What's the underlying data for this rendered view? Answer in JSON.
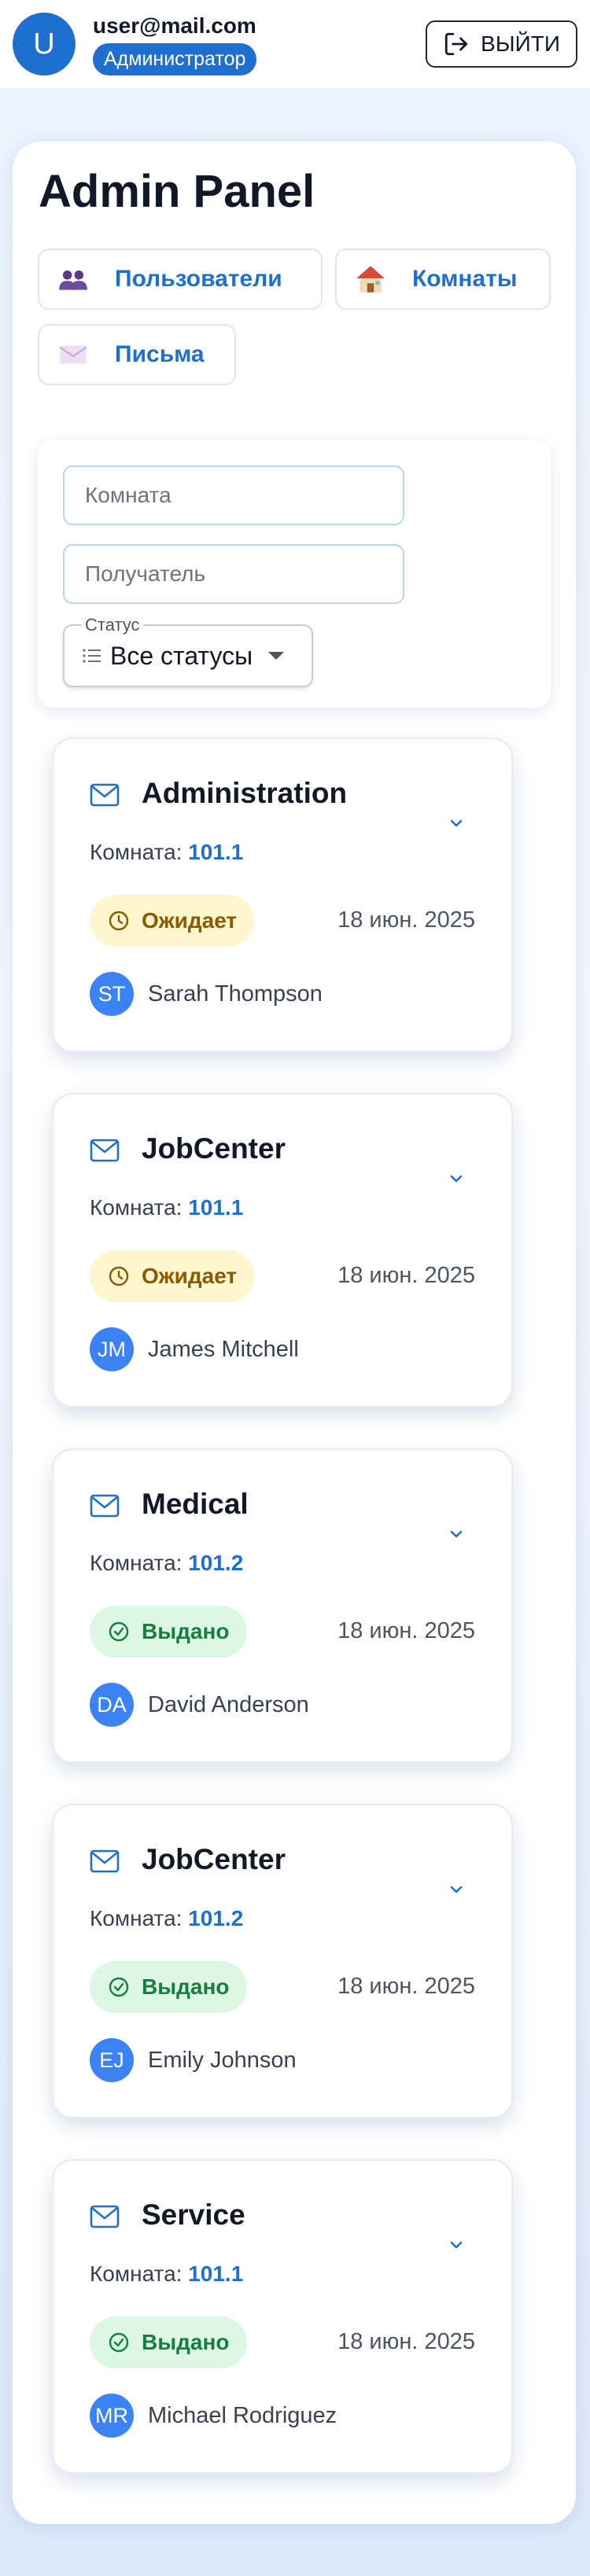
{
  "header": {
    "avatar_letter": "U",
    "email": "user@mail.com",
    "role": "Администратор",
    "logout_label": "ВЫЙТИ"
  },
  "panel": {
    "title": "Admin Panel",
    "nav": [
      {
        "label": "Пользователи",
        "icon": "users-icon"
      },
      {
        "label": "Комнаты",
        "icon": "house-icon"
      },
      {
        "label": "Письма",
        "icon": "envelope-icon"
      }
    ]
  },
  "filters": {
    "room_placeholder": "Комната",
    "recipient_placeholder": "Получатель",
    "status_label": "Статус",
    "status_value": "Все статусы"
  },
  "mails": [
    {
      "title": "Administration",
      "room_label": "Комната:",
      "room": "101.1",
      "status": "Ожидает",
      "status_type": "waiting",
      "date": "18 июн. 2025",
      "initials": "ST",
      "sender": "Sarah Thompson"
    },
    {
      "title": "JobCenter",
      "room_label": "Комната:",
      "room": "101.1",
      "status": "Ожидает",
      "status_type": "waiting",
      "date": "18 июн. 2025",
      "initials": "JM",
      "sender": "James Mitchell"
    },
    {
      "title": "Medical",
      "room_label": "Комната:",
      "room": "101.2",
      "status": "Выдано",
      "status_type": "issued",
      "date": "18 июн. 2025",
      "initials": "DA",
      "sender": "David Anderson"
    },
    {
      "title": "JobCenter",
      "room_label": "Комната:",
      "room": "101.2",
      "status": "Выдано",
      "status_type": "issued",
      "date": "18 июн. 2025",
      "initials": "EJ",
      "sender": "Emily Johnson"
    },
    {
      "title": "Service",
      "room_label": "Комната:",
      "room": "101.1",
      "status": "Выдано",
      "status_type": "issued",
      "date": "18 июн. 2025",
      "initials": "MR",
      "sender": "Michael Rodriguez"
    }
  ],
  "colors": {
    "accent": "#1f6fd1",
    "waiting_bg": "#fdf6cf",
    "waiting_text": "#8a5a00",
    "issued_bg": "#dcf7e4",
    "issued_text": "#15803d"
  }
}
